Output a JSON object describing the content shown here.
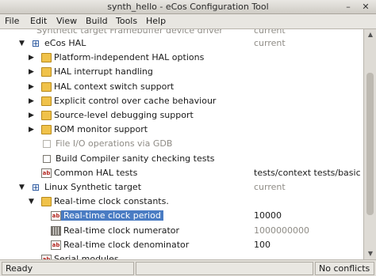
{
  "window": {
    "title": "synth_hello - eCos Configuration Tool",
    "minimize_glyph": "–",
    "close_glyph": "✕"
  },
  "menubar": {
    "file": "File",
    "edit": "Edit",
    "view": "View",
    "build": "Build",
    "tools": "Tools",
    "help": "Help"
  },
  "tree": {
    "top_cut_label": "Synthetic target Framebuffer device driver",
    "top_cut_value": "current",
    "rows": [
      {
        "label": "eCos HAL",
        "value": "current",
        "icon": "package-icon",
        "arrow": "expanded"
      },
      {
        "label": "Platform-independent HAL options",
        "value": "",
        "icon": "folder-icon",
        "arrow": "collapsed"
      },
      {
        "label": "HAL interrupt handling",
        "value": "",
        "icon": "folder-icon",
        "arrow": "collapsed"
      },
      {
        "label": "HAL context switch support",
        "value": "",
        "icon": "folder-icon",
        "arrow": "collapsed"
      },
      {
        "label": "Explicit control over cache behaviour",
        "value": "",
        "icon": "folder-icon",
        "arrow": "collapsed"
      },
      {
        "label": "Source-level debugging support",
        "value": "",
        "icon": "folder-icon",
        "arrow": "collapsed"
      },
      {
        "label": "ROM monitor support",
        "value": "",
        "icon": "folder-icon",
        "arrow": "collapsed"
      },
      {
        "label": "File I/O operations via GDB",
        "value": "",
        "icon": "checkbox-icon",
        "arrow": "none",
        "disabled": true
      },
      {
        "label": "Build Compiler sanity checking tests",
        "value": "",
        "icon": "checkbox-icon",
        "arrow": "none"
      },
      {
        "label": "Common HAL tests",
        "value": "tests/context tests/basic",
        "icon": "text-value-icon",
        "arrow": "none"
      },
      {
        "label": "Linux Synthetic target",
        "value": "current",
        "icon": "package-icon",
        "arrow": "expanded"
      },
      {
        "label": "Real-time clock constants.",
        "value": "",
        "icon": "folder-icon",
        "arrow": "expanded"
      },
      {
        "label": "Real-time clock period",
        "value": "10000",
        "icon": "text-value-icon",
        "arrow": "none",
        "selected": true
      },
      {
        "label": "Real-time clock numerator",
        "value": "1000000000",
        "icon": "number-value-icon",
        "arrow": "none",
        "value_disabled": true
      },
      {
        "label": "Real-time clock denominator",
        "value": "100",
        "icon": "text-value-icon",
        "arrow": "none"
      }
    ],
    "bottom_cut_label": "Serial modules"
  },
  "status": {
    "left": "Ready",
    "middle": "",
    "right": "No conflicts"
  },
  "colors": {
    "selection": "#4a7cc3",
    "folder": "#f0c24a",
    "disabled_text": "#8f8c86"
  }
}
